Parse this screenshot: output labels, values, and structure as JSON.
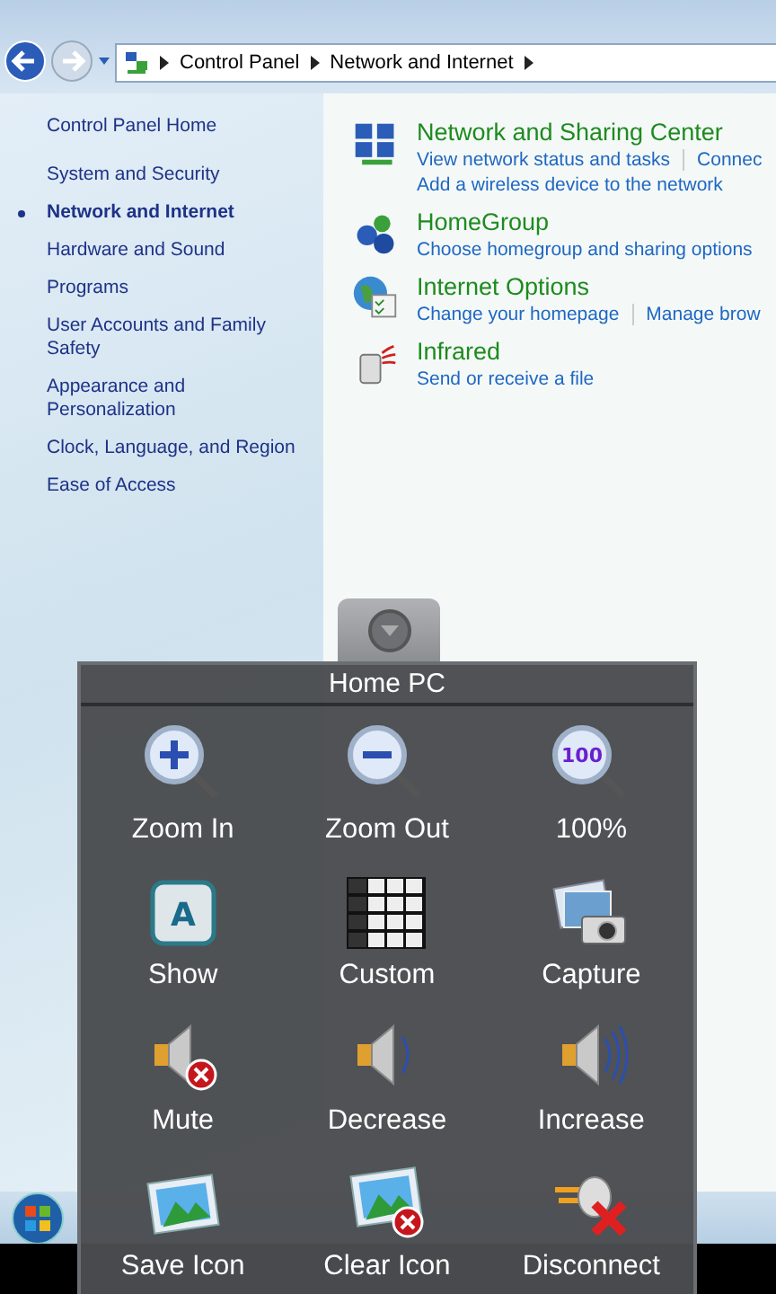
{
  "breadcrumb": [
    "Control Panel",
    "Network and Internet"
  ],
  "sidebar": {
    "items": [
      {
        "label": "Control Panel Home",
        "selected": false
      },
      {
        "label": "System and Security",
        "selected": false
      },
      {
        "label": "Network and Internet",
        "selected": true
      },
      {
        "label": "Hardware and Sound",
        "selected": false
      },
      {
        "label": "Programs",
        "selected": false
      },
      {
        "label": "User Accounts and Family Safety",
        "selected": false
      },
      {
        "label": "Appearance and Personalization",
        "selected": false
      },
      {
        "label": "Clock, Language, and Region",
        "selected": false
      },
      {
        "label": "Ease of Access",
        "selected": false
      }
    ]
  },
  "categories": [
    {
      "kind": "network",
      "title": "Network and Sharing Center",
      "links": [
        "View network status and tasks",
        "Connec",
        "Add a wireless device to the network"
      ]
    },
    {
      "kind": "homegroup",
      "title": "HomeGroup",
      "links": [
        "Choose homegroup and sharing options"
      ]
    },
    {
      "kind": "internet",
      "title": "Internet Options",
      "links": [
        "Change your homepage",
        "Manage brow"
      ]
    },
    {
      "kind": "infrared",
      "title": "Infrared",
      "links": [
        "Send or receive a file"
      ]
    }
  ],
  "remote_panel": {
    "title": "Home PC",
    "buttons": [
      {
        "kind": "zoom-in",
        "label": "Zoom In"
      },
      {
        "kind": "zoom-out",
        "label": "Zoom Out"
      },
      {
        "kind": "zoom-100",
        "label": "100%",
        "badge": "100"
      },
      {
        "kind": "show",
        "label": "Show",
        "badge": "A"
      },
      {
        "kind": "keyboard",
        "label": "Custom"
      },
      {
        "kind": "camera",
        "label": "Capture"
      },
      {
        "kind": "mute",
        "label": "Mute"
      },
      {
        "kind": "decrease",
        "label": "Decrease"
      },
      {
        "kind": "increase",
        "label": "Increase"
      },
      {
        "kind": "save-image",
        "label": "Save Icon"
      },
      {
        "kind": "clear-image",
        "label": "Clear Icon"
      },
      {
        "kind": "disconnect",
        "label": "Disconnect"
      }
    ]
  }
}
